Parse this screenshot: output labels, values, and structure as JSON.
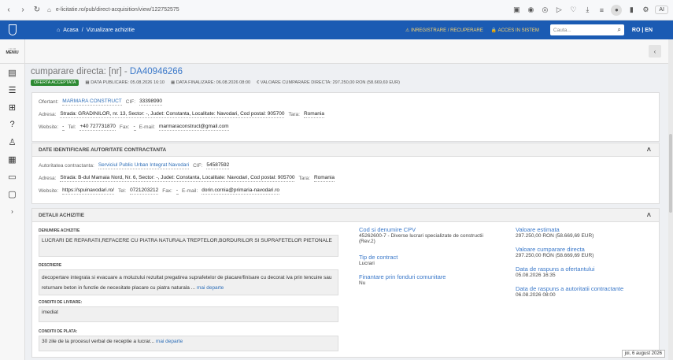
{
  "browser": {
    "url": "e-licitatie.ro/pub/direct-acquisition/view/122752575",
    "ai_label": "AI"
  },
  "topbar": {
    "home": "Acasa",
    "separator": "/",
    "current": "Vizualizare achizitie",
    "register": "INREGISTRARE / RECUPERARE",
    "access": "ACCES IN SISTEM",
    "search_placeholder": "Cauta...",
    "lang": "RO | EN"
  },
  "sidebar": {
    "menu_label": "MENIU"
  },
  "page": {
    "title_prefix": "cumparare directa: [nr] - ",
    "title_code": "DA40946266",
    "status": "OFERTA ACCEPTATA",
    "publish": "DATA PUBLICARE: 05.08.2026 16:10",
    "final": "DATA FINALIZARE: 06.08.2026 08:00",
    "value": "€ VALOARE CUMPARARE DIRECTA: 297.250,00  RON (58.669,69  EUR)"
  },
  "offerer": {
    "label_name": "Ofertant:",
    "name": "MARMARA CONSTRUCT",
    "label_cif": "CIF:",
    "cif": "33398990",
    "label_address": "Adresa:",
    "address": "Strada: GRADINILOR, nr. 13, Sector: -, Judet: Constanta, Localitate: Navodari, Cod postal: 905700",
    "label_country": "Tara:",
    "country": "Romania",
    "label_web": "Website:",
    "web": "-",
    "label_tel": "Tel:",
    "tel": "+40 727731870",
    "label_fax": "Fax:",
    "fax": "-",
    "label_email": "E-mail:",
    "email": "marmaraconstruct@gmail.com"
  },
  "authority": {
    "heading": "DATE IDENTIFICARE AUTORITATE CONTRACTANTA",
    "label_name": "Autoritatea contractanta:",
    "name": "Serviciul Public Urban Integrat Navodari",
    "label_cif": "CIF:",
    "cif": "54587592",
    "label_address": "Adresa:",
    "address": "Strada: B-dul Mamaia Nord, Nr. 6, Sector: -, Judet: Constanta, Localitate: Navodari, Cod postal: 905700",
    "label_country": "Tara:",
    "country": "Romania",
    "label_web": "Website:",
    "web": "https://spuinavodari.ro/",
    "label_tel": "Tel:",
    "tel": "0721203212",
    "label_fax": "Fax:",
    "fax": "-",
    "label_email": "E-mail:",
    "email": "dorin.cornia@primaria-navodari.ro"
  },
  "details": {
    "heading": "DETALII ACHIZITIE",
    "denumire_label": "DENUMIRE ACHIZITIE",
    "denumire": "LUCRARI DE REPARATII,REFACERE CU PIATRA NATURALA TREPTELOR,BORDURILOR SI SUPRAFETELOR PIETONALE",
    "descriere_label": "DESCRIERE",
    "descriere": "decopertare integrala si evacuare a moluzului rezultat pregatirea suprafetelor de placare/finisare cu decorat iva prin tencuire sau returnare beton in functie de necesitate placare cu piatra naturala ...",
    "more": "mai departe",
    "livrare_label": "CONDITII DE LIVRARE:",
    "livrare": "imediat",
    "plata_label": "CONDITII DE PLATA:",
    "plata": "30 zile de la procesul verbal de receptie a lucrar...",
    "cpv_title": "Cod si denumire CPV",
    "cpv": "45262600-7 - Diverse lucrari specializate de constructii (Rev.2)",
    "tip_title": "Tip de contract",
    "tip": "Lucrari",
    "fin_title": "Finantare prin fonduri comunitare",
    "fin": "Nu",
    "val_est_title": "Valoare estimata",
    "val_est": "297.250,00  RON (58.669,69  EUR)",
    "val_cump_title": "Valoare cumparare directa",
    "val_cump": "297.250,00  RON (58.669,69  EUR)",
    "termen_oferta_title": "Data de raspuns a ofertantului",
    "termen_oferta": "05.08.2026 16:35",
    "termen_aut_title": "Data de raspuns a autoritatii contractante",
    "termen_aut": "06.08.2026 08:00"
  },
  "status_date": "joi, 6 august 2026"
}
